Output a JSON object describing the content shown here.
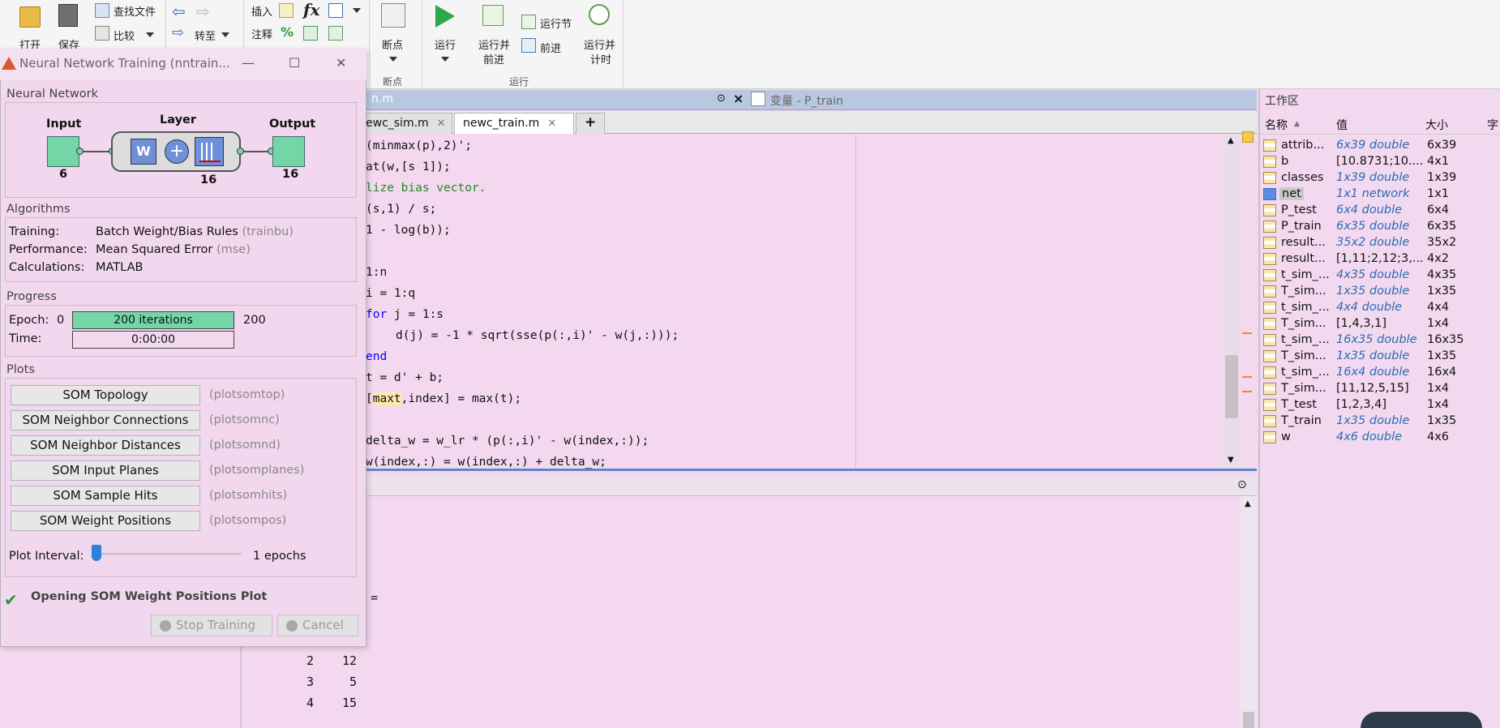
{
  "ribbon": {
    "open": "打开",
    "save": "保存",
    "find_files": "查找文件",
    "compare": "比较",
    "goto": "转至",
    "insert": "插入",
    "comment": "注释",
    "fx": "fx",
    "breakpoints": "断点",
    "breakpoints_group": "断点",
    "run": "运行",
    "run_advance_l1": "运行并",
    "run_advance_l2": "前进",
    "run_section": "运行节",
    "advance": "前进",
    "run_time_l1": "运行并",
    "run_time_l2": "计时",
    "run_group": "运行"
  },
  "editor": {
    "title_tab": "n.m",
    "variables_tab": "变量 - P_train",
    "files": [
      {
        "label": "ewc_sim.m",
        "active": false
      },
      {
        "label": "newc_train.m",
        "active": true
      },
      {
        "label": "+",
        "active": false
      }
    ],
    "lines": [
      {
        "text": "(minmax(p),2)';",
        "indent": 0
      },
      {
        "text": "at(w,[s 1]);",
        "indent": 0
      },
      {
        "text": "lize bias vector.",
        "indent": 0
      },
      {
        "text": "(s,1) / s;",
        "indent": 0
      },
      {
        "text": "1 - log(b));",
        "indent": 0
      },
      {
        "text": "",
        "indent": 0
      },
      {
        "text": "1:n",
        "indent": 0
      },
      {
        "text": "i = 1:q",
        "indent": 0
      },
      {
        "text": "for j = 1:s",
        "indent": 0
      },
      {
        "text": "d(j) = -1 * sqrt(sse(p(:,i)' - w(j,:)));",
        "indent": 1
      },
      {
        "text": "end",
        "indent": 0
      },
      {
        "text": "t = d' + b;",
        "indent": 0
      },
      {
        "text": "[maxt,index] = max(t);",
        "indent": 0
      },
      {
        "text": "",
        "indent": 0
      },
      {
        "text": "delta_w = w_lr * (p(:,i)' - w(index,:));",
        "indent": 0
      },
      {
        "text": "w(index,:) = w(index,:) + delta_w;",
        "indent": 0
      }
    ],
    "hl_word": "maxt"
  },
  "command": {
    "eq": "=",
    "rows": [
      {
        "a": "2",
        "b": "12"
      },
      {
        "a": "3",
        "b": "5"
      },
      {
        "a": "4",
        "b": "15"
      }
    ]
  },
  "workspace": {
    "title": "工作区",
    "col_name": "名称",
    "col_value": "值",
    "col_size": "大小",
    "col_extra": "字",
    "rows": [
      {
        "name": "attrib...",
        "value": "6x39 double",
        "size": "6x39",
        "italic": true
      },
      {
        "name": "b",
        "value": "[10.8731;10....",
        "size": "4x1",
        "italic": false
      },
      {
        "name": "classes",
        "value": "1x39 double",
        "size": "1x39",
        "italic": true
      },
      {
        "name": "net",
        "value": "1x1 network",
        "size": "1x1",
        "italic": true
      },
      {
        "name": "P_test",
        "value": "6x4 double",
        "size": "6x4",
        "italic": true
      },
      {
        "name": "P_train",
        "value": "6x35 double",
        "size": "6x35",
        "italic": true
      },
      {
        "name": "result...",
        "value": "35x2 double",
        "size": "35x2",
        "italic": true
      },
      {
        "name": "result...",
        "value": "[1,11;2,12;3,...",
        "size": "4x2",
        "italic": false
      },
      {
        "name": "t_sim_...",
        "value": "4x35 double",
        "size": "4x35",
        "italic": true
      },
      {
        "name": "T_sim...",
        "value": "1x35 double",
        "size": "1x35",
        "italic": true
      },
      {
        "name": "t_sim_...",
        "value": "4x4 double",
        "size": "4x4",
        "italic": true
      },
      {
        "name": "T_sim...",
        "value": "[1,4,3,1]",
        "size": "1x4",
        "italic": false
      },
      {
        "name": "t_sim_...",
        "value": "16x35 double",
        "size": "16x35",
        "italic": true
      },
      {
        "name": "T_sim...",
        "value": "1x35 double",
        "size": "1x35",
        "italic": true
      },
      {
        "name": "t_sim_...",
        "value": "16x4 double",
        "size": "16x4",
        "italic": true
      },
      {
        "name": "T_sim...",
        "value": "[11,12,5,15]",
        "size": "1x4",
        "italic": false
      },
      {
        "name": "T_test",
        "value": "[1,2,3,4]",
        "size": "1x4",
        "italic": false
      },
      {
        "name": "T_train",
        "value": "1x35 double",
        "size": "1x35",
        "italic": true
      },
      {
        "name": "w",
        "value": "4x6 double",
        "size": "4x6",
        "italic": true
      }
    ],
    "selected_index": 3
  },
  "dialog": {
    "title": "Neural Network Training (nntrain...",
    "nn_section": "Neural Network",
    "input_label": "Input",
    "input_size": "6",
    "layer_label": "Layer",
    "layer_size": "16",
    "output_label": "Output",
    "output_size": "16",
    "weight_symbol": "W",
    "algorithms_section": "Algorithms",
    "training_key": "Training:",
    "training_val": "Batch Weight/Bias Rules",
    "training_fn": "(trainbu)",
    "performance_key": "Performance:",
    "performance_val": "Mean Squared Error",
    "performance_fn": "(mse)",
    "calculations_key": "Calculations:",
    "calculations_val": "MATLAB",
    "progress_section": "Progress",
    "epoch_key": "Epoch:",
    "epoch_start": "0",
    "epoch_bar": "200 iterations",
    "epoch_end": "200",
    "epoch_progress": 1.0,
    "time_key": "Time:",
    "time_val": "0:00:00",
    "plots_section": "Plots",
    "plots": [
      {
        "label": "SOM Topology",
        "fn": "(plotsomtop)"
      },
      {
        "label": "SOM Neighbor Connections",
        "fn": "(plotsomnc)"
      },
      {
        "label": "SOM Neighbor Distances",
        "fn": "(plotsomnd)"
      },
      {
        "label": "SOM Input Planes",
        "fn": "(plotsomplanes)"
      },
      {
        "label": "SOM Sample Hits",
        "fn": "(plotsomhits)"
      },
      {
        "label": "SOM Weight Positions",
        "fn": "(plotsompos)"
      }
    ],
    "plot_interval_key": "Plot Interval:",
    "plot_interval_val": "1 epochs",
    "plot_interval_level": 0.0,
    "status": "Opening SOM Weight Positions Plot",
    "stop_training": "Stop Training",
    "cancel": "Cancel"
  },
  "colors": {
    "background": "#f3d8f0",
    "progress_fill": "#74d6a6",
    "keyword": "#0000ff",
    "comment": "#228b22",
    "workspace_italic": "#2b6cb0"
  }
}
